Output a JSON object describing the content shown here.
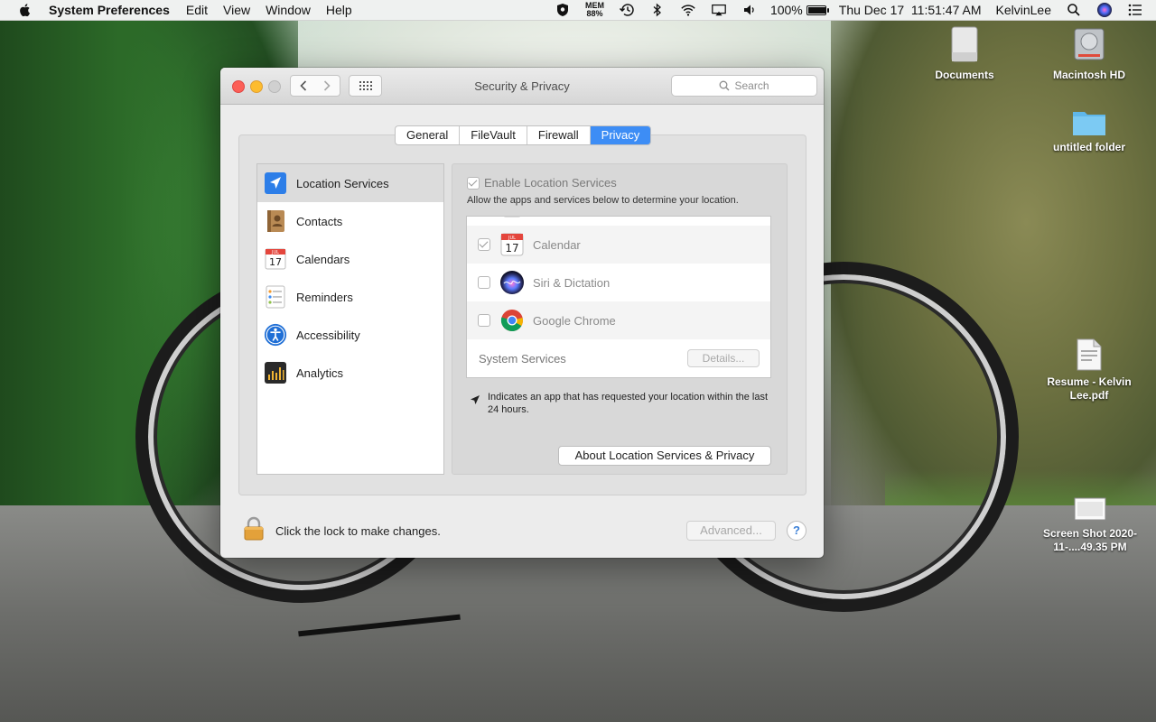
{
  "menubar": {
    "app_name": "System Preferences",
    "menus": [
      "Edit",
      "View",
      "Window",
      "Help"
    ],
    "mem_label": "MEM",
    "mem_value": "88%",
    "battery": "100%",
    "battery_level": 1.0,
    "datetime": "Thu Dec 17  11:51:47 AM",
    "user": "KelvinLee"
  },
  "desktop": {
    "icons": [
      {
        "label": "Documents"
      },
      {
        "label": "Macintosh HD"
      },
      {
        "label": "untitled folder"
      },
      {
        "label": "Resume - Kelvin Lee.pdf"
      },
      {
        "label": "Screen Shot 2020-11-....49.35 PM"
      }
    ]
  },
  "window": {
    "title": "Security & Privacy",
    "search_placeholder": "Search",
    "tabs": [
      {
        "label": "General",
        "active": false
      },
      {
        "label": "FileVault",
        "active": false
      },
      {
        "label": "Firewall",
        "active": false
      },
      {
        "label": "Privacy",
        "active": true
      }
    ],
    "sidebar": [
      {
        "label": "Location Services",
        "icon": "location-arrow-icon",
        "selected": true
      },
      {
        "label": "Contacts",
        "icon": "contacts-book-icon",
        "selected": false
      },
      {
        "label": "Calendars",
        "icon": "calendar-icon",
        "selected": false
      },
      {
        "label": "Reminders",
        "icon": "reminders-list-icon",
        "selected": false
      },
      {
        "label": "Accessibility",
        "icon": "accessibility-person-icon",
        "selected": false
      },
      {
        "label": "Analytics",
        "icon": "analytics-grid-icon",
        "selected": false
      }
    ],
    "location": {
      "enable_label": "Enable Location Services",
      "enable_checked": true,
      "description": "Allow the apps and services below to determine your location.",
      "apps": [
        {
          "label": "Calendar",
          "checked": true,
          "icon": "calendar-icon"
        },
        {
          "label": "Siri & Dictation",
          "checked": false,
          "icon": "siri-orb-icon"
        },
        {
          "label": "Google Chrome",
          "checked": false,
          "icon": "chrome-logo-icon"
        }
      ],
      "system_services_label": "System Services",
      "details_button": "Details...",
      "note": "Indicates an app that has requested your location within the last 24 hours.",
      "about_button": "About Location Services & Privacy"
    },
    "calendar_icon_month": "JUL",
    "calendar_icon_day": "17",
    "lock_text": "Click the lock to make changes.",
    "advanced_button": "Advanced...",
    "help_button": "?"
  },
  "colors": {
    "accent": "#3d8df5",
    "close": "#fc5f57",
    "minimize": "#fdbc2e",
    "lock": "#e3a13a"
  }
}
